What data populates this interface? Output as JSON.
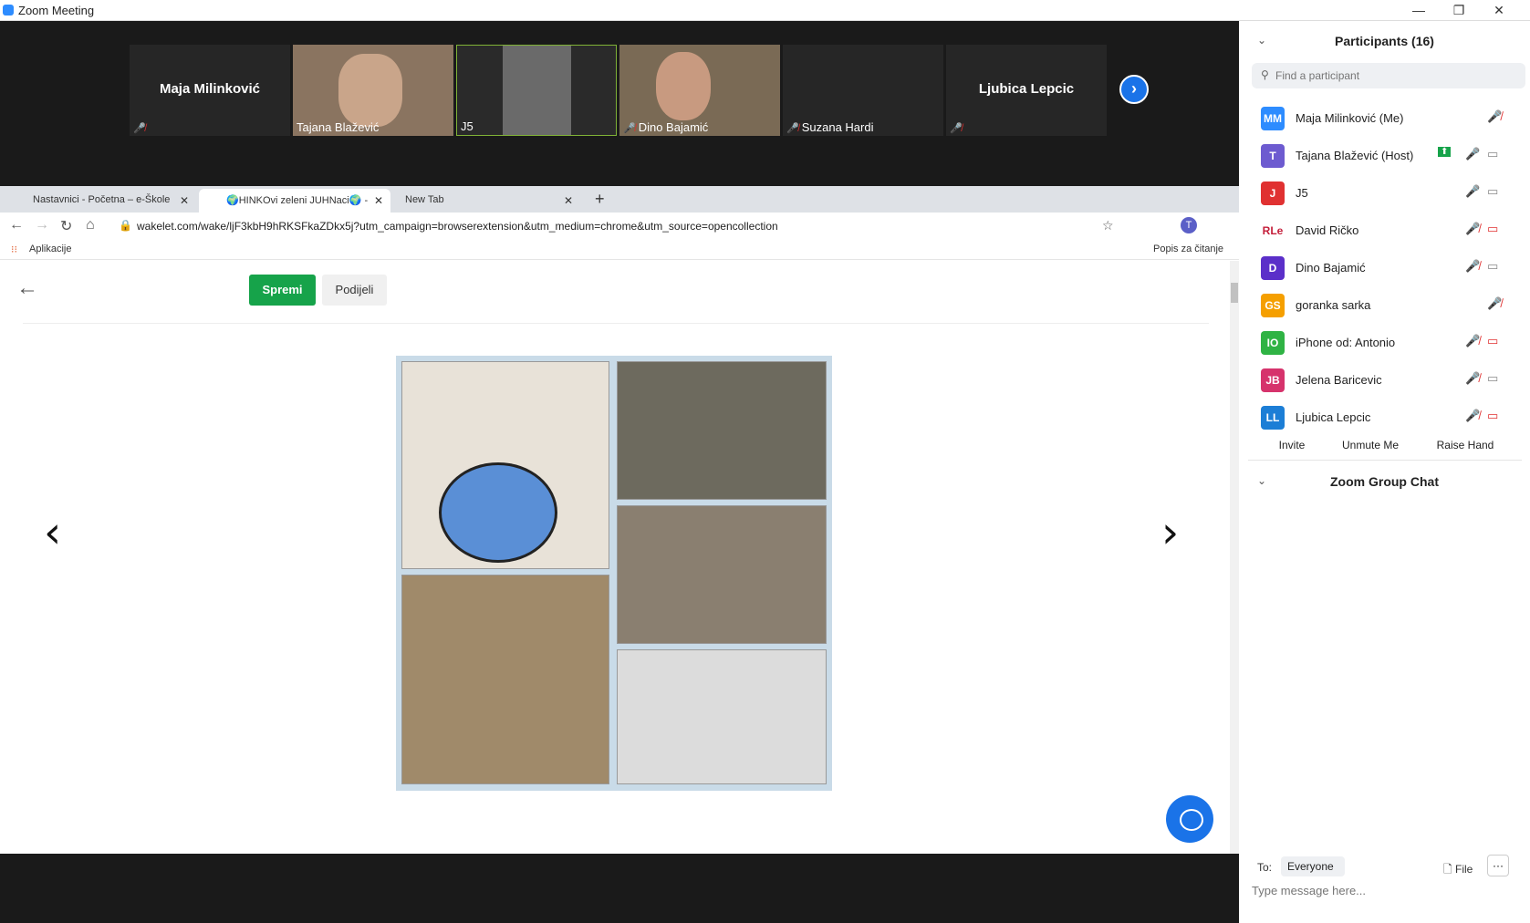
{
  "window": {
    "title": "Zoom Meeting",
    "minimize": "—",
    "restore": "❐",
    "close": "✕"
  },
  "gallery": {
    "tiles": [
      {
        "name": "Maja Milinković",
        "caption": "",
        "muted": true,
        "video": false
      },
      {
        "name": "",
        "caption": "Tajana Blažević",
        "muted": false,
        "video": true,
        "color": "#8a7460"
      },
      {
        "name": "",
        "caption": "J5",
        "muted": false,
        "video": true,
        "color": "#3b3b3b"
      },
      {
        "name": "",
        "caption": "Dino Bajamić",
        "muted": true,
        "video": true,
        "color": "#7a6a55"
      },
      {
        "name": "",
        "caption": "Suzana Hardi",
        "muted": true,
        "video": false
      },
      {
        "name": "Ljubica Lepcic",
        "caption": "",
        "muted": true,
        "video": false
      }
    ],
    "next_icon": "›"
  },
  "browser": {
    "tabs": [
      {
        "label": "Nastavnici - Početna – e-Škole"
      },
      {
        "label": "🌍HINKOvi zeleni JUHNaci🌍 - "
      },
      {
        "label": "New Tab"
      }
    ],
    "new_tab": "+",
    "url": "wakelet.com/wake/ljF3kbH9hRKSFkaZDkx5j?utm_campaign=browserextension&utm_medium=chrome&utm_source=opencollection",
    "bookmarks": {
      "apps": "Aplikacije",
      "reading_list": "Popis za čitanje"
    },
    "page": {
      "save": "Spremi",
      "share": "Podijeli",
      "prev": "‹",
      "next": "›"
    }
  },
  "participants": {
    "header": "Participants (16)",
    "search_placeholder": "Find a participant",
    "list": [
      {
        "initials": "MM",
        "name": "Maja Milinković (Me)",
        "color": "#2d8cff",
        "mic": "off",
        "cam": "none"
      },
      {
        "initials": "T",
        "name": "Tajana Blažević (Host)",
        "color": "#6d5bd0",
        "mic": "on",
        "cam": "on",
        "share": true
      },
      {
        "initials": "J",
        "name": "J5",
        "color": "#e03131",
        "mic": "on",
        "cam": "on"
      },
      {
        "initials": "RLe",
        "name": "David Ričko",
        "color": "#ffffff",
        "mic": "off",
        "cam": "off"
      },
      {
        "initials": "D",
        "name": "Dino Bajamić",
        "color": "#5b2fc9",
        "mic": "off",
        "cam": "on"
      },
      {
        "initials": "GS",
        "name": "goranka sarka",
        "color": "#f59f00",
        "mic": "off",
        "cam": "none"
      },
      {
        "initials": "IO",
        "name": "iPhone od: Antonio",
        "color": "#2fb344",
        "mic": "off",
        "cam": "off"
      },
      {
        "initials": "JB",
        "name": "Jelena Baricevic",
        "color": "#d6336c",
        "mic": "off",
        "cam": "on"
      },
      {
        "initials": "LL",
        "name": "Ljubica Lepcic",
        "color": "#1c7ed6",
        "mic": "off",
        "cam": "off"
      }
    ],
    "buttons": {
      "invite": "Invite",
      "unmute": "Unmute Me",
      "raise": "Raise Hand"
    }
  },
  "chat": {
    "header": "Zoom Group Chat",
    "to_label": "To:",
    "to_value": "Everyone",
    "file": "File",
    "more": "···",
    "placeholder": "Type message here..."
  }
}
